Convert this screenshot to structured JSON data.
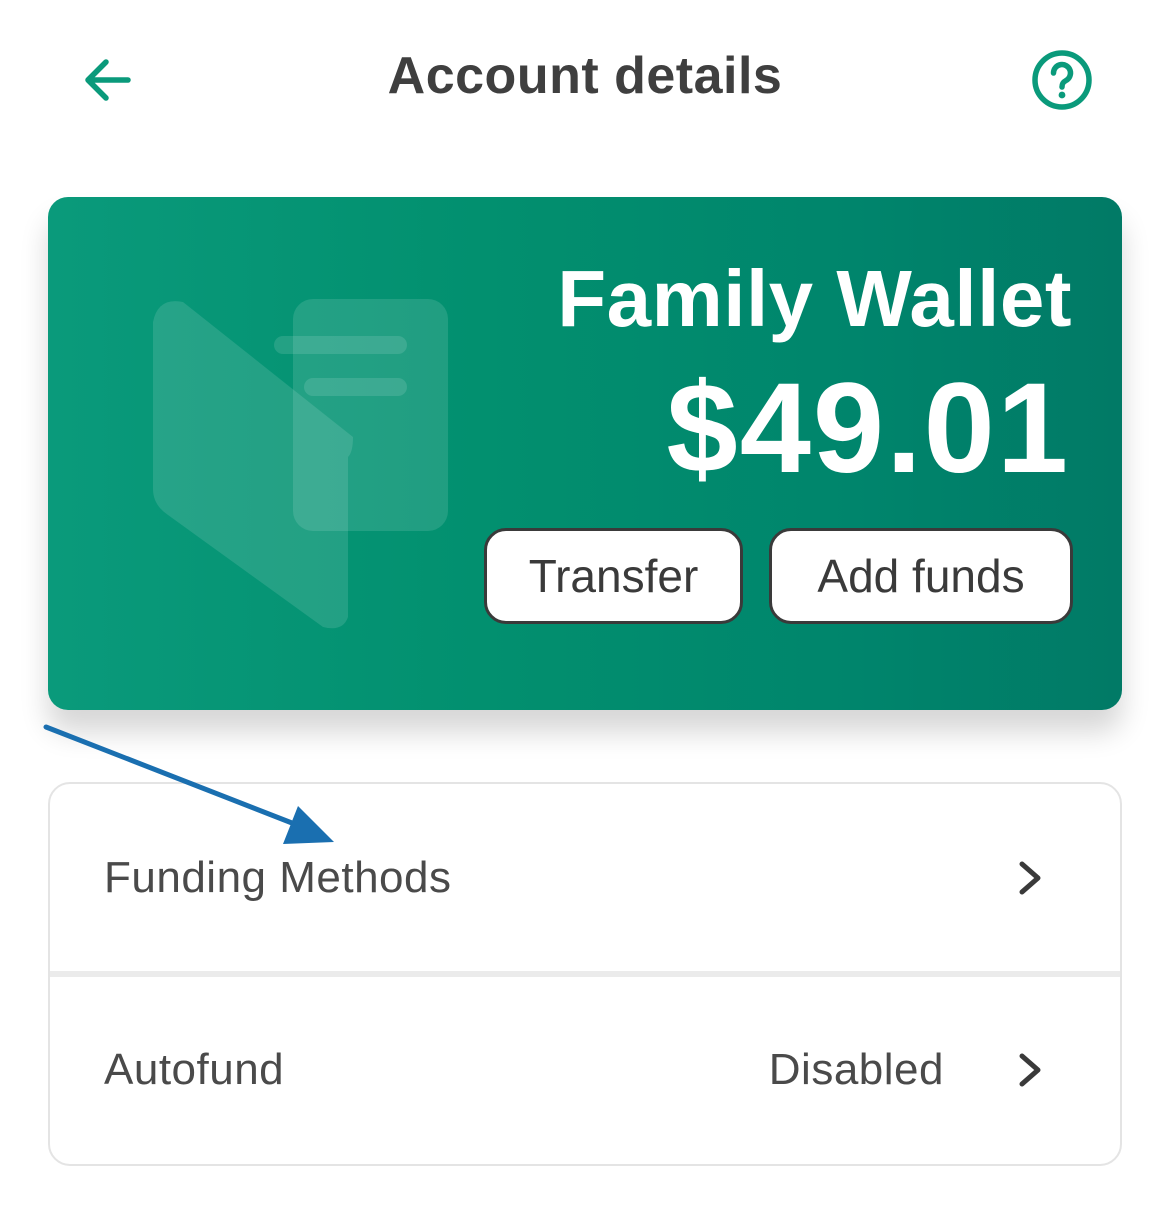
{
  "header": {
    "title": "Account details",
    "back_icon": "arrow-left-icon",
    "help_icon": "question-circle-icon"
  },
  "wallet": {
    "name": "Family Wallet",
    "balance": "$49.01",
    "illustration_icon": "wallet-icon",
    "transfer_label": "Transfer",
    "add_funds_label": "Add funds"
  },
  "settings": {
    "rows": [
      {
        "label": "Funding Methods",
        "value": "",
        "icon": "chevron-right-icon"
      },
      {
        "label": "Autofund",
        "value": "Disabled",
        "icon": "chevron-right-icon"
      }
    ]
  },
  "colors": {
    "accent": "#0a9a7b",
    "card_dark": "#017a66",
    "title_text": "#3f3f3f",
    "annotation_arrow": "#1a6fb0"
  }
}
